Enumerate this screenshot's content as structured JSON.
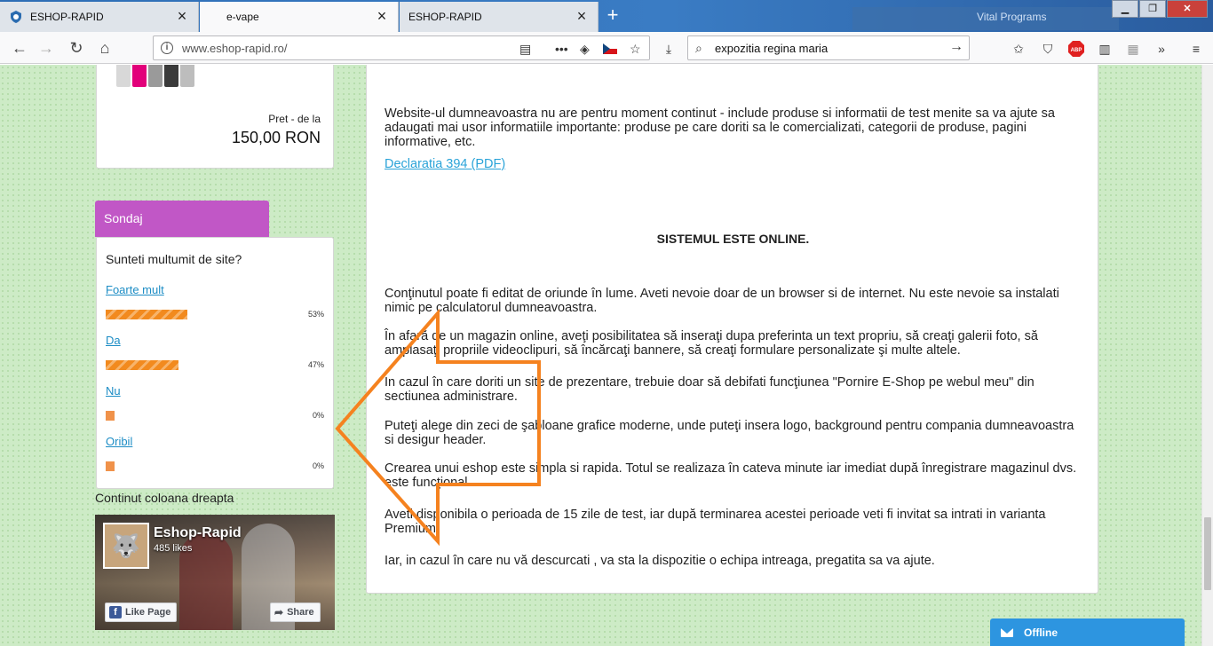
{
  "browser": {
    "tabs": [
      {
        "title": "ESHOP-RAPID",
        "active": false
      },
      {
        "title": "e-vape",
        "active": true
      },
      {
        "title": "ESHOP-RAPID",
        "active": false
      }
    ],
    "window_deco_text": "Vital Programs",
    "url": "www.eshop-rapid.ro/",
    "search_value": "expozitia regina maria"
  },
  "product": {
    "price_label": "Pret - de la",
    "price_value": "150,00 RON"
  },
  "poll": {
    "tab_label": "Sondaj",
    "question": "Sunteti multumit de site?",
    "options": [
      {
        "label": "Foarte mult",
        "percent": 53,
        "percent_text": "53%"
      },
      {
        "label": "Da",
        "percent": 47,
        "percent_text": "47%"
      },
      {
        "label": "Nu",
        "percent": 0,
        "percent_text": "0%"
      },
      {
        "label": "Oribil",
        "percent": 0,
        "percent_text": "0%"
      }
    ]
  },
  "right_column_label": "Continut coloana dreapta",
  "facebook": {
    "page_name": "Eshop-Rapid",
    "likes": "485 likes",
    "like_button": "Like Page",
    "share_button": "Share"
  },
  "content": {
    "intro": "Website-ul dumneavoastra nu are pentru moment continut - include produse si informatii de test menite sa va ajute sa adaugati mai usor informatiile importante: produse pe care doriti sa le comercializati, categorii de produse, pagini informative, etc.",
    "declaration_link": "Declaratia 394 (PDF)",
    "online_title": "SISTEMUL ESTE ONLINE.",
    "paragraphs": [
      "Conţinutul poate fi editat de oriunde în lume. Aveti nevoie doar  de un browser si de internet. Nu este nevoie sa instalati nimic pe calculatorul dumneavoastra.",
      "În afară de un magazin online, aveţi posibilitatea să inseraţi dupa preferinta un text propriu, să creaţi galerii foto, să amplasaţi propriile videoclipuri, să încărcaţi bannere, să creaţi formulare personalizate şi multe altele.",
      "In cazul în care doriti un site de prezentare, trebuie doar să debifati funcţiunea \"Pornire E-Shop pe webul meu\" din sectiunea administrare.",
      "Puteţi alege din zeci de şabloane grafice moderne, unde puteţi insera logo, background pentru compania dumneavoastra si desigur header.",
      "Crearea unui eshop este simpla si rapida. Totul se realizaza în cateva minute iar imediat după înregistrare magazinul dvs. este funcţional.",
      "Aveti disponibila o perioada de 15 zile de test, iar după terminarea acestei perioade veti fi invitat sa intrati in varianta Premium.",
      "Iar, in cazul în care nu vă descurcati , va sta la dispozitie o echipa intreaga, pregatita sa va ajute."
    ]
  },
  "chat": {
    "status": "Offline"
  },
  "colors": {
    "poll_tab": "#c157c6",
    "link": "#2aa3d8",
    "annotation_arrow": "#f5821f",
    "chat": "#2d95e0"
  }
}
